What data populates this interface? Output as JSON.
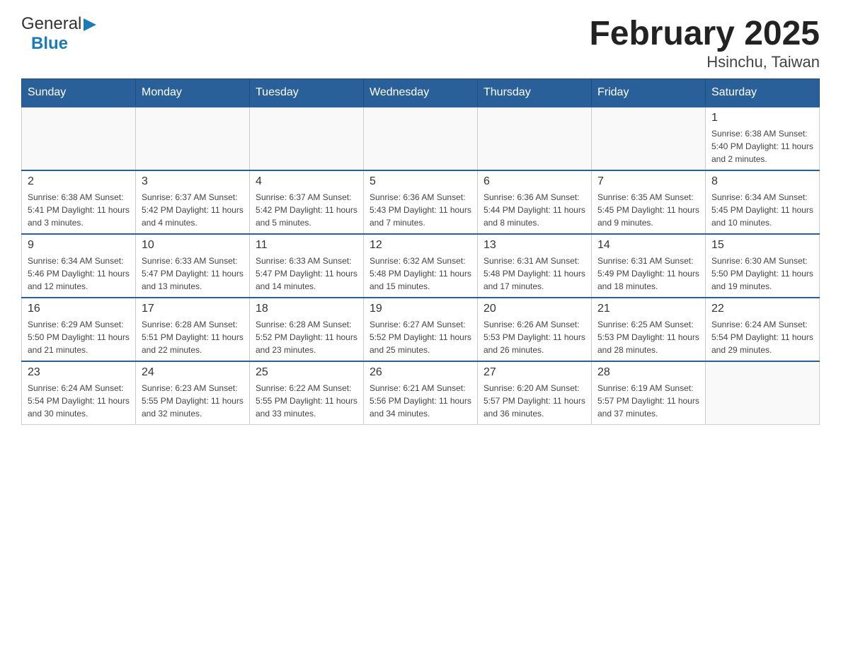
{
  "header": {
    "logo": {
      "general": "General",
      "blue": "Blue"
    },
    "title": "February 2025",
    "subtitle": "Hsinchu, Taiwan"
  },
  "weekdays": [
    "Sunday",
    "Monday",
    "Tuesday",
    "Wednesday",
    "Thursday",
    "Friday",
    "Saturday"
  ],
  "weeks": [
    [
      {
        "day": "",
        "info": ""
      },
      {
        "day": "",
        "info": ""
      },
      {
        "day": "",
        "info": ""
      },
      {
        "day": "",
        "info": ""
      },
      {
        "day": "",
        "info": ""
      },
      {
        "day": "",
        "info": ""
      },
      {
        "day": "1",
        "info": "Sunrise: 6:38 AM\nSunset: 5:40 PM\nDaylight: 11 hours\nand 2 minutes."
      }
    ],
    [
      {
        "day": "2",
        "info": "Sunrise: 6:38 AM\nSunset: 5:41 PM\nDaylight: 11 hours\nand 3 minutes."
      },
      {
        "day": "3",
        "info": "Sunrise: 6:37 AM\nSunset: 5:42 PM\nDaylight: 11 hours\nand 4 minutes."
      },
      {
        "day": "4",
        "info": "Sunrise: 6:37 AM\nSunset: 5:42 PM\nDaylight: 11 hours\nand 5 minutes."
      },
      {
        "day": "5",
        "info": "Sunrise: 6:36 AM\nSunset: 5:43 PM\nDaylight: 11 hours\nand 7 minutes."
      },
      {
        "day": "6",
        "info": "Sunrise: 6:36 AM\nSunset: 5:44 PM\nDaylight: 11 hours\nand 8 minutes."
      },
      {
        "day": "7",
        "info": "Sunrise: 6:35 AM\nSunset: 5:45 PM\nDaylight: 11 hours\nand 9 minutes."
      },
      {
        "day": "8",
        "info": "Sunrise: 6:34 AM\nSunset: 5:45 PM\nDaylight: 11 hours\nand 10 minutes."
      }
    ],
    [
      {
        "day": "9",
        "info": "Sunrise: 6:34 AM\nSunset: 5:46 PM\nDaylight: 11 hours\nand 12 minutes."
      },
      {
        "day": "10",
        "info": "Sunrise: 6:33 AM\nSunset: 5:47 PM\nDaylight: 11 hours\nand 13 minutes."
      },
      {
        "day": "11",
        "info": "Sunrise: 6:33 AM\nSunset: 5:47 PM\nDaylight: 11 hours\nand 14 minutes."
      },
      {
        "day": "12",
        "info": "Sunrise: 6:32 AM\nSunset: 5:48 PM\nDaylight: 11 hours\nand 15 minutes."
      },
      {
        "day": "13",
        "info": "Sunrise: 6:31 AM\nSunset: 5:48 PM\nDaylight: 11 hours\nand 17 minutes."
      },
      {
        "day": "14",
        "info": "Sunrise: 6:31 AM\nSunset: 5:49 PM\nDaylight: 11 hours\nand 18 minutes."
      },
      {
        "day": "15",
        "info": "Sunrise: 6:30 AM\nSunset: 5:50 PM\nDaylight: 11 hours\nand 19 minutes."
      }
    ],
    [
      {
        "day": "16",
        "info": "Sunrise: 6:29 AM\nSunset: 5:50 PM\nDaylight: 11 hours\nand 21 minutes."
      },
      {
        "day": "17",
        "info": "Sunrise: 6:28 AM\nSunset: 5:51 PM\nDaylight: 11 hours\nand 22 minutes."
      },
      {
        "day": "18",
        "info": "Sunrise: 6:28 AM\nSunset: 5:52 PM\nDaylight: 11 hours\nand 23 minutes."
      },
      {
        "day": "19",
        "info": "Sunrise: 6:27 AM\nSunset: 5:52 PM\nDaylight: 11 hours\nand 25 minutes."
      },
      {
        "day": "20",
        "info": "Sunrise: 6:26 AM\nSunset: 5:53 PM\nDaylight: 11 hours\nand 26 minutes."
      },
      {
        "day": "21",
        "info": "Sunrise: 6:25 AM\nSunset: 5:53 PM\nDaylight: 11 hours\nand 28 minutes."
      },
      {
        "day": "22",
        "info": "Sunrise: 6:24 AM\nSunset: 5:54 PM\nDaylight: 11 hours\nand 29 minutes."
      }
    ],
    [
      {
        "day": "23",
        "info": "Sunrise: 6:24 AM\nSunset: 5:54 PM\nDaylight: 11 hours\nand 30 minutes."
      },
      {
        "day": "24",
        "info": "Sunrise: 6:23 AM\nSunset: 5:55 PM\nDaylight: 11 hours\nand 32 minutes."
      },
      {
        "day": "25",
        "info": "Sunrise: 6:22 AM\nSunset: 5:55 PM\nDaylight: 11 hours\nand 33 minutes."
      },
      {
        "day": "26",
        "info": "Sunrise: 6:21 AM\nSunset: 5:56 PM\nDaylight: 11 hours\nand 34 minutes."
      },
      {
        "day": "27",
        "info": "Sunrise: 6:20 AM\nSunset: 5:57 PM\nDaylight: 11 hours\nand 36 minutes."
      },
      {
        "day": "28",
        "info": "Sunrise: 6:19 AM\nSunset: 5:57 PM\nDaylight: 11 hours\nand 37 minutes."
      },
      {
        "day": "",
        "info": ""
      }
    ]
  ]
}
